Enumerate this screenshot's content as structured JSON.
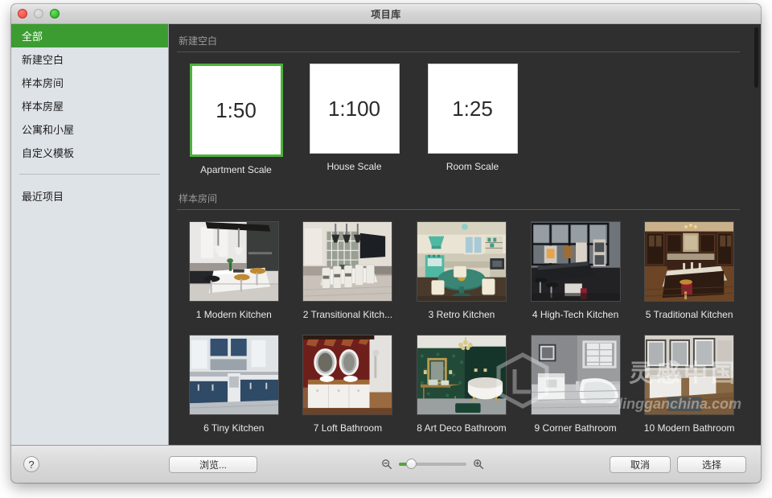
{
  "window": {
    "title": "项目库",
    "traffic_lights": [
      "close-red",
      "minimize-gray",
      "zoom-green"
    ]
  },
  "sidebar": {
    "items": [
      {
        "label": "全部",
        "selected": true
      },
      {
        "label": "新建空白",
        "selected": false
      },
      {
        "label": "样本房间",
        "selected": false
      },
      {
        "label": "样本房屋",
        "selected": false
      },
      {
        "label": "公寓和小屋",
        "selected": false
      },
      {
        "label": "自定义模板",
        "selected": false
      }
    ],
    "recent": {
      "label": "最近项目"
    }
  },
  "content": {
    "sections": [
      {
        "header": "新建空白",
        "items": [
          {
            "label": "Apartment Scale",
            "scale": "1:50",
            "selected": true
          },
          {
            "label": "House Scale",
            "scale": "1:100",
            "selected": false
          },
          {
            "label": "Room Scale",
            "scale": "1:25",
            "selected": false
          }
        ]
      },
      {
        "header": "样本房间",
        "row1": [
          {
            "label": "1 Modern Kitchen"
          },
          {
            "label": "2 Transitional Kitch..."
          },
          {
            "label": "3 Retro Kitchen"
          },
          {
            "label": "4 High-Tech Kitchen"
          },
          {
            "label": "5 Traditional Kitchen"
          }
        ],
        "row2": [
          {
            "label": "6 Tiny Kitchen"
          },
          {
            "label": "7 Loft Bathroom"
          },
          {
            "label": "8 Art Deco Bathroom"
          },
          {
            "label": "9 Corner Bathroom"
          },
          {
            "label": "10 Modern Bathroom"
          }
        ]
      }
    ]
  },
  "bottombar": {
    "help_label": "?",
    "browse_label": "浏览...",
    "zoom_out_icon": "zoom-out-icon",
    "zoom_in_icon": "zoom-in-icon",
    "zoom_value": 12,
    "cancel_label": "取消",
    "select_label": "选择"
  },
  "watermark": {
    "title": "灵感中国",
    "url": "lingganchina.com"
  },
  "colors": {
    "accent_green": "#3c9c32",
    "selection_green": "#4eb23c",
    "content_bg": "#2f2f2f",
    "sidebar_bg": "#dee3e8"
  }
}
